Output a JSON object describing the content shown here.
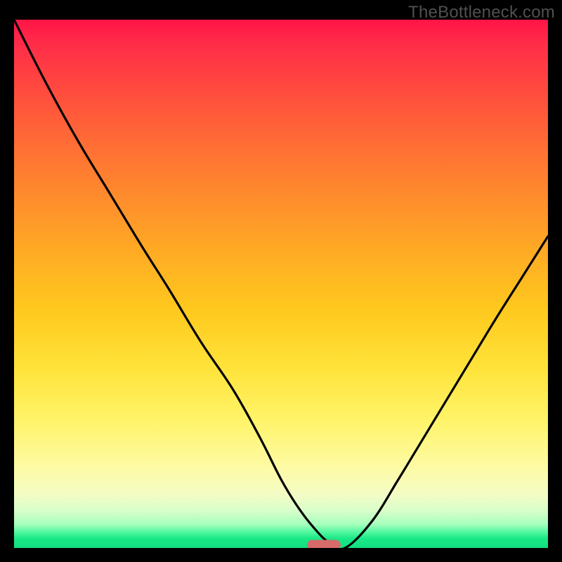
{
  "watermark": "TheBottleneck.com",
  "chart_data": {
    "type": "line",
    "title": "",
    "xlabel": "",
    "ylabel": "",
    "xlim": [
      0,
      100
    ],
    "ylim": [
      0,
      100
    ],
    "grid": false,
    "gradient_stops": [
      {
        "pct": 0,
        "color": "#ff1547"
      },
      {
        "pct": 5,
        "color": "#ff2e48"
      },
      {
        "pct": 12,
        "color": "#ff4640"
      },
      {
        "pct": 22,
        "color": "#ff6836"
      },
      {
        "pct": 33,
        "color": "#ff8a2d"
      },
      {
        "pct": 44,
        "color": "#ffab24"
      },
      {
        "pct": 55,
        "color": "#ffc91e"
      },
      {
        "pct": 66,
        "color": "#ffe33a"
      },
      {
        "pct": 76,
        "color": "#fff46a"
      },
      {
        "pct": 85,
        "color": "#fdfba6"
      },
      {
        "pct": 90,
        "color": "#f3fcc6"
      },
      {
        "pct": 93,
        "color": "#d7feca"
      },
      {
        "pct": 95.5,
        "color": "#a7ffbd"
      },
      {
        "pct": 97,
        "color": "#52f8a0"
      },
      {
        "pct": 98.2,
        "color": "#1ae886"
      },
      {
        "pct": 100,
        "color": "#12e081"
      }
    ],
    "series": [
      {
        "name": "bottleneck-curve",
        "x": [
          0,
          6,
          12,
          18,
          24,
          29,
          35,
          41,
          46,
          50,
          53,
          56,
          59,
          62,
          67,
          72,
          78,
          84,
          90,
          95,
          100
        ],
        "y": [
          100,
          88,
          77,
          67,
          57,
          49,
          39,
          30,
          21,
          13,
          8,
          4,
          1,
          0,
          5,
          13,
          23,
          33,
          43,
          51,
          59
        ]
      }
    ],
    "marker": {
      "x": 58,
      "y": 0.5,
      "color": "#d76b6a",
      "shape": "rounded-rect"
    }
  }
}
